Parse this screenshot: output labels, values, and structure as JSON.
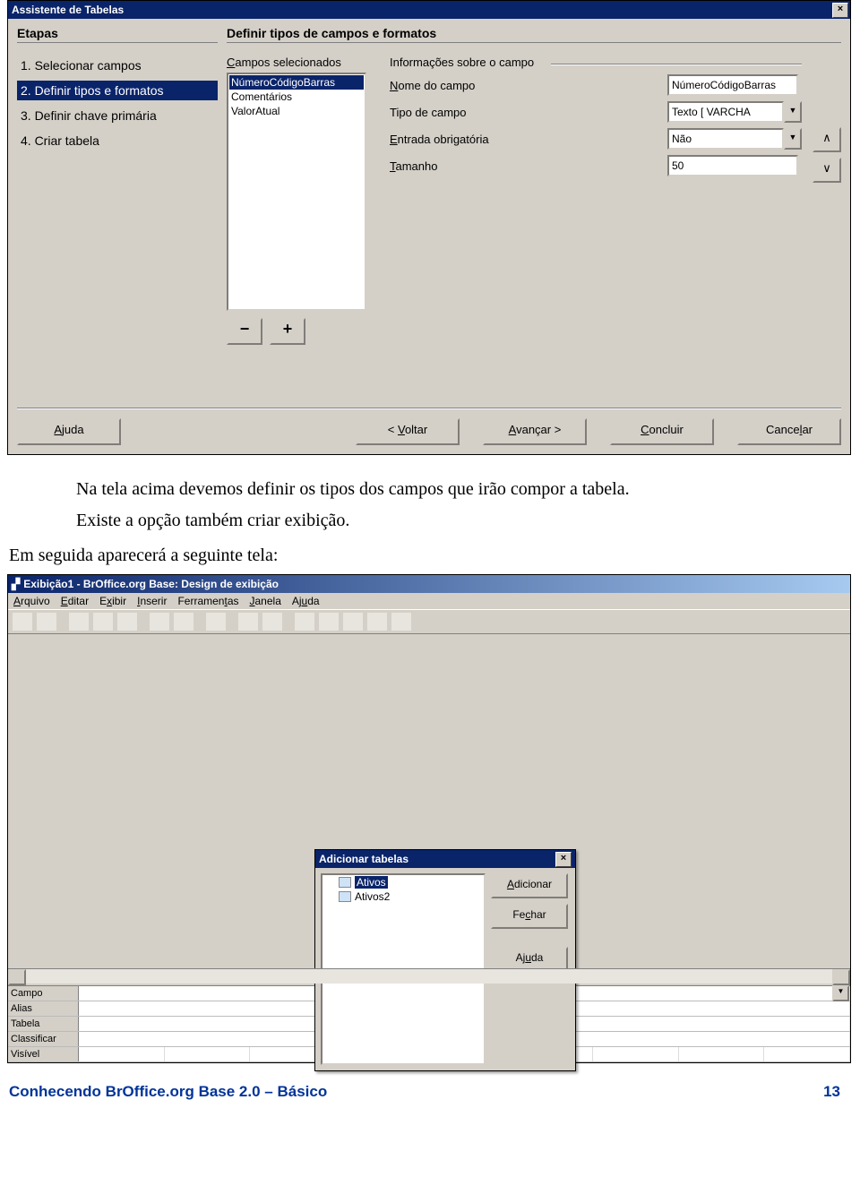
{
  "wizard": {
    "title": "Assistente de Tabelas",
    "left_header": "Etapas",
    "right_header": "Definir tipos de campos e formatos",
    "steps": [
      "1.  Selecionar campos",
      "2.  Definir tipos e formatos",
      "3.  Definir chave primária",
      "4.  Criar tabela"
    ],
    "active_step_index": 1,
    "selected_fields_label": "Campos selecionados",
    "selected_fields": [
      "NúmeroCódigoBarras",
      "Comentários",
      "ValorAtual"
    ],
    "selected_field_active_index": 0,
    "info_label": "Informações sobre o campo",
    "form": {
      "name_label": "Nome do campo",
      "name_value": "NúmeroCódigoBarras",
      "type_label": "Tipo de campo",
      "type_value": "Texto [ VARCHA",
      "required_label": "Entrada obrigatória",
      "required_value": "Não",
      "size_label": "Tamanho",
      "size_value": "50"
    },
    "arrow_up": "∧",
    "arrow_down": "∨",
    "minus": "−",
    "plus": "+",
    "buttons": {
      "help": "Ajuda",
      "back": "< Voltar",
      "next": "Avançar >",
      "finish": "Concluir",
      "cancel": "Cancelar"
    }
  },
  "paragraph": {
    "p1": "Na tela acima devemos definir os tipos dos campos que irão compor a tabela.",
    "p2": "Existe a opção também criar exibição.",
    "p3": "Em seguida aparecerá a seguinte tela:"
  },
  "view": {
    "title": "Exibição1 - BrOffice.org Base: Design de exibição",
    "menus": [
      "Arquivo",
      "Editar",
      "Exibir",
      "Inserir",
      "Ferramentas",
      "Janela",
      "Ajuda"
    ],
    "add_dialog": {
      "title": "Adicionar tabelas",
      "items": [
        "Ativos",
        "Ativos2"
      ],
      "selected_index": 0,
      "add": "Adicionar",
      "close": "Fechar",
      "help": "Ajuda"
    },
    "grid_rows": [
      "Campo",
      "Alias",
      "Tabela",
      "Classificar",
      "Visível"
    ]
  },
  "footer": {
    "left": "Conhecendo BrOffice.org Base 2.0 – Básico",
    "right": "13"
  }
}
